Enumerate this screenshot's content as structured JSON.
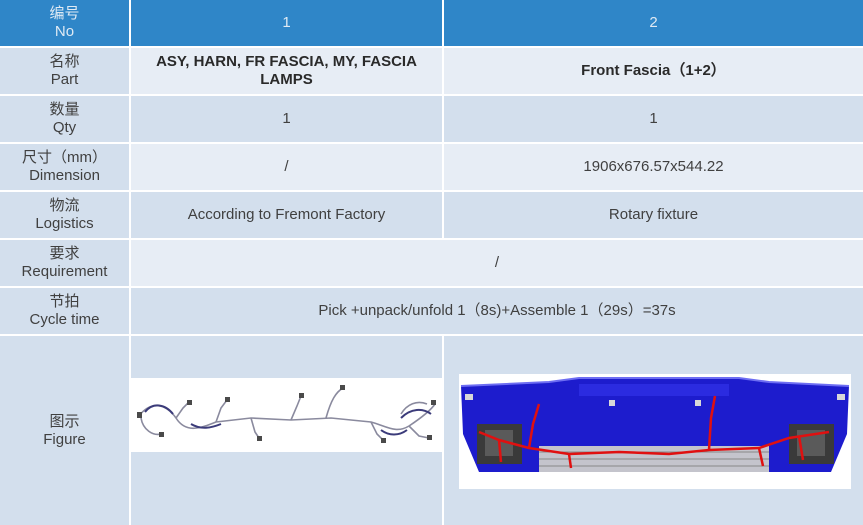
{
  "header": {
    "label_cn": "编号",
    "label_en": "No",
    "col1": "1",
    "col2": "2"
  },
  "rows": {
    "part": {
      "label_cn": "名称",
      "label_en": "Part",
      "col1": "ASY, HARN, FR FASCIA, MY, FASCIA LAMPS",
      "col2": "Front Fascia（1+2）"
    },
    "qty": {
      "label_cn": "数量",
      "label_en": "Qty",
      "col1": "1",
      "col2": "1"
    },
    "dimension": {
      "label_cn": "尺寸（mm）",
      "label_en": "Dimension",
      "col1": "/",
      "col2": "1906x676.57x544.22"
    },
    "logistics": {
      "label_cn": "物流",
      "label_en": "Logistics",
      "col1": "According to Fremont Factory",
      "col2": "Rotary fixture"
    },
    "requirement": {
      "label_cn": "要求",
      "label_en": "Requirement",
      "value": "/"
    },
    "cycle": {
      "label_cn": "节拍",
      "label_en": "Cycle time",
      "value": "Pick +unpack/unfold 1（8s)+Assemble 1（29s）=37s"
    },
    "figure": {
      "label_cn": "图示",
      "label_en": "Figure"
    }
  },
  "colors": {
    "header": "#2f86c8",
    "label": "#d3dfed",
    "row_light": "#e7edf5",
    "fascia_blue": "#1d1ccd",
    "harness_red": "#e01010"
  }
}
